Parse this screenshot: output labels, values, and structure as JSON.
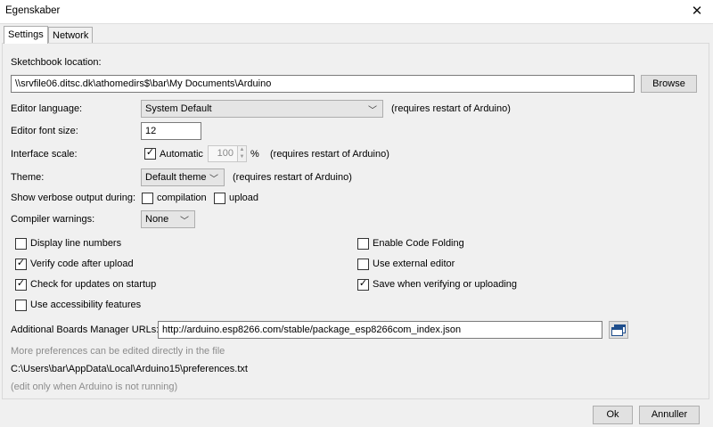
{
  "window": {
    "title": "Egenskaber",
    "close_glyph": "✕"
  },
  "tabs": [
    {
      "label": "Settings",
      "active": true
    },
    {
      "label": "Network",
      "active": false
    }
  ],
  "sketchbook": {
    "label": "Sketchbook location:",
    "value": "\\\\srvfile06.ditsc.dk\\athomedirs$\\bar\\My Documents\\Arduino",
    "browse_label": "Browse"
  },
  "editor_language": {
    "label": "Editor language:",
    "selected": "System Default",
    "note": "(requires restart of Arduino)"
  },
  "editor_font_size": {
    "label": "Editor font size:",
    "value": "12"
  },
  "interface_scale": {
    "label": "Interface scale:",
    "automatic_label": "Automatic",
    "automatic_checked": true,
    "value": "100",
    "unit": "%",
    "note": "(requires restart of Arduino)"
  },
  "theme": {
    "label": "Theme:",
    "selected": "Default theme",
    "note": "(requires restart of Arduino)"
  },
  "verbose": {
    "label": "Show verbose output during:",
    "compilation_label": "compilation",
    "compilation_checked": false,
    "upload_label": "upload",
    "upload_checked": false
  },
  "compiler_warnings": {
    "label": "Compiler warnings:",
    "selected": "None"
  },
  "options_left": [
    {
      "label": "Display line numbers",
      "checked": false
    },
    {
      "label": "Verify code after upload",
      "checked": true
    },
    {
      "label": "Check for updates on startup",
      "checked": true
    },
    {
      "label": "Use accessibility features",
      "checked": false
    }
  ],
  "options_right": [
    {
      "label": "Enable Code Folding",
      "checked": false
    },
    {
      "label": "Use external editor",
      "checked": false
    },
    {
      "label": "Save when verifying or uploading",
      "checked": true
    }
  ],
  "boards_manager": {
    "label": "Additional Boards Manager URLs:",
    "value": "http://arduino.esp8266.com/stable/package_esp8266com_index.json",
    "icon": "window-list-icon"
  },
  "footer_notes": {
    "more_prefs": "More preferences can be edited directly in the file",
    "prefs_path": "C:\\Users\\bar\\AppData\\Local\\Arduino15\\preferences.txt",
    "edit_note": "(edit only when Arduino is not running)"
  },
  "buttons": {
    "ok": "Ok",
    "cancel": "Annuller"
  },
  "colors": {
    "accent": "#0078d7",
    "dialog_bg": "#f0f0f0",
    "muted_text": "#8c8c8c"
  }
}
